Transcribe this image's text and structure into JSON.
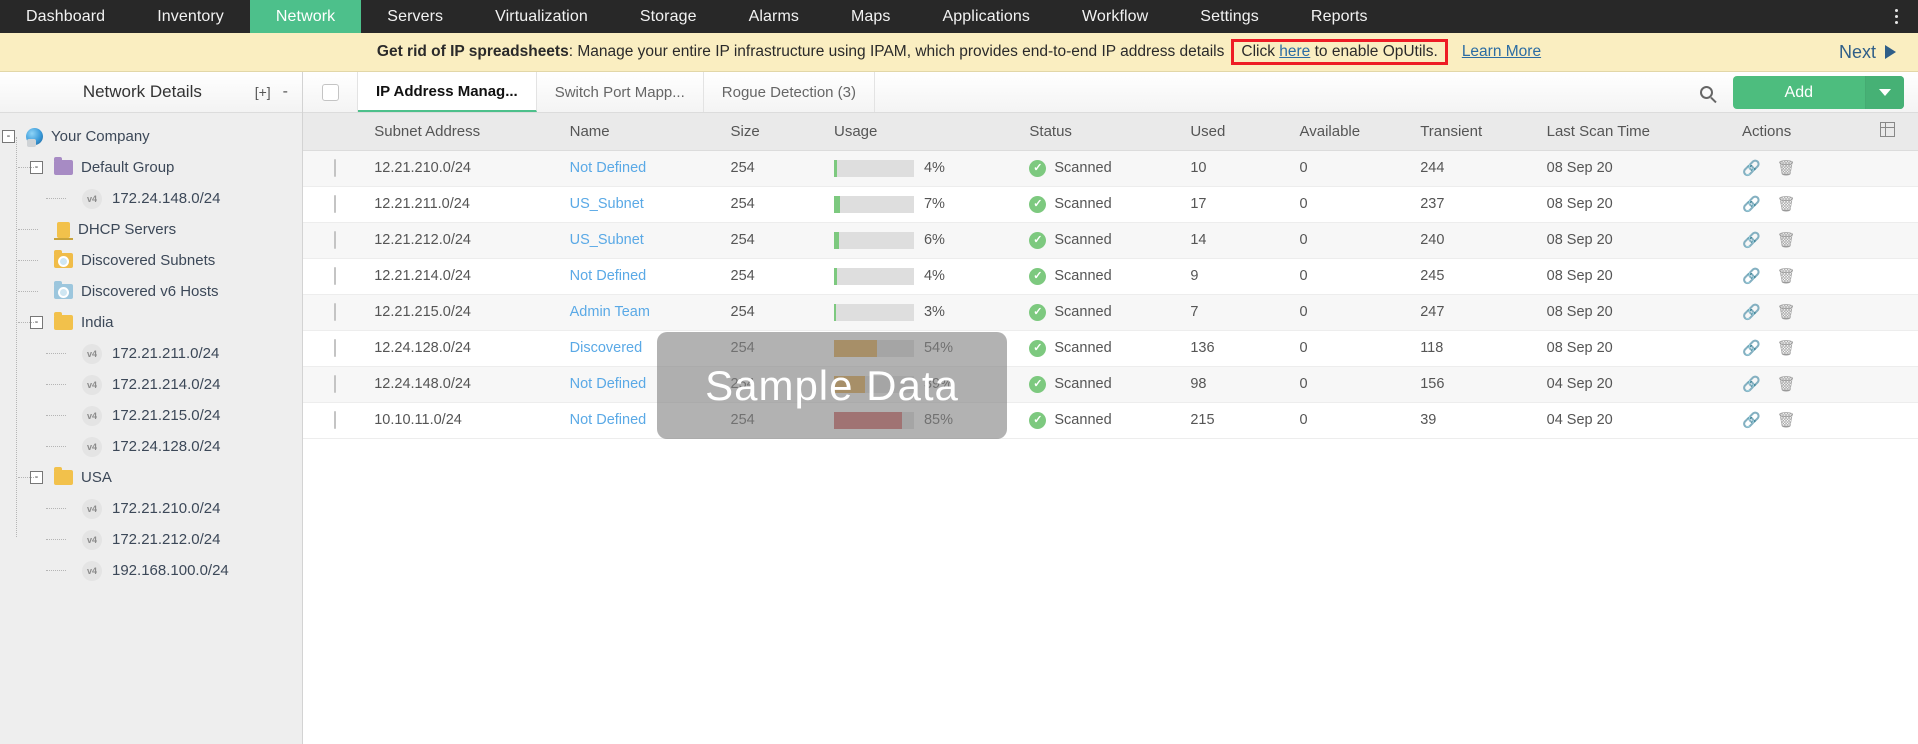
{
  "topnav": {
    "items": [
      {
        "label": "Dashboard",
        "active": false
      },
      {
        "label": "Inventory",
        "active": false
      },
      {
        "label": "Network",
        "active": true
      },
      {
        "label": "Servers",
        "active": false
      },
      {
        "label": "Virtualization",
        "active": false
      },
      {
        "label": "Storage",
        "active": false
      },
      {
        "label": "Alarms",
        "active": false
      },
      {
        "label": "Maps",
        "active": false
      },
      {
        "label": "Applications",
        "active": false
      },
      {
        "label": "Workflow",
        "active": false
      },
      {
        "label": "Settings",
        "active": false
      },
      {
        "label": "Reports",
        "active": false
      }
    ],
    "accent_color": "#4dc08b",
    "background_color": "#282828",
    "overflow_icon": "kebab-menu-icon"
  },
  "banner": {
    "bold_text": "Get rid of IP spreadsheets",
    "body_text": ": Manage your entire IP infrastructure using IPAM, which provides end-to-end IP address details",
    "cta_prefix": "Click ",
    "cta_link": "here",
    "cta_suffix": " to enable OpUtils.",
    "learn_more": "Learn More",
    "next_label": "Next",
    "highlight_color": "#ee1c25",
    "background_color": "#faeec1"
  },
  "sidebar": {
    "title": "Network Details",
    "expand_all": "[+]",
    "collapse_all": "-",
    "tree": [
      {
        "label": "Your Company",
        "icon": "globe-icon",
        "depth": 0,
        "toggle": "-"
      },
      {
        "label": "Default Group",
        "icon": "folder-purple-icon",
        "depth": 1,
        "toggle": "-"
      },
      {
        "label": "172.24.148.0/24",
        "icon": "ipv4-icon",
        "depth": 2,
        "toggle": ""
      },
      {
        "label": "DHCP Servers",
        "icon": "dhcp-server-icon",
        "depth": 1,
        "toggle": ""
      },
      {
        "label": "Discovered Subnets",
        "icon": "folder-search-icon",
        "depth": 1,
        "toggle": ""
      },
      {
        "label": "Discovered v6 Hosts",
        "icon": "folder-search-v6-icon",
        "depth": 1,
        "toggle": ""
      },
      {
        "label": "India",
        "icon": "folder-yellow-icon",
        "depth": 1,
        "toggle": "-"
      },
      {
        "label": "172.21.211.0/24",
        "icon": "ipv4-icon",
        "depth": 2,
        "toggle": ""
      },
      {
        "label": "172.21.214.0/24",
        "icon": "ipv4-icon",
        "depth": 2,
        "toggle": ""
      },
      {
        "label": "172.21.215.0/24",
        "icon": "ipv4-icon",
        "depth": 2,
        "toggle": ""
      },
      {
        "label": "172.24.128.0/24",
        "icon": "ipv4-icon",
        "depth": 2,
        "toggle": ""
      },
      {
        "label": "USA",
        "icon": "folder-yellow-icon",
        "depth": 1,
        "toggle": "-"
      },
      {
        "label": "172.21.210.0/24",
        "icon": "ipv4-icon",
        "depth": 2,
        "toggle": ""
      },
      {
        "label": "172.21.212.0/24",
        "icon": "ipv4-icon",
        "depth": 2,
        "toggle": ""
      },
      {
        "label": "192.168.100.0/24",
        "icon": "ipv4-icon",
        "depth": 2,
        "toggle": ""
      }
    ]
  },
  "toolbar": {
    "select_all_checkbox": "",
    "tabs": [
      {
        "label": "IP Address Manag...",
        "active": true
      },
      {
        "label": "Switch Port Mapp...",
        "active": false
      },
      {
        "label": "Rogue Detection (3)",
        "active": false
      }
    ],
    "search_icon": "search-icon",
    "add_label": "Add",
    "add_caret_icon": "chevron-down-icon",
    "add_color": "#4dbd7e"
  },
  "table": {
    "columns": [
      "Subnet Address",
      "Name",
      "Size",
      "Usage",
      "Status",
      "Used",
      "Available",
      "Transient",
      "Last Scan Time",
      "Actions"
    ],
    "grid_icon": "column-chooser-icon",
    "rows": [
      {
        "subnet": "12.21.210.0/24",
        "name": "Not Defined",
        "size": "254",
        "usage_pct": 4,
        "usage_label": "4%",
        "status": "Scanned",
        "used": "10",
        "available": "0",
        "transient": "244",
        "last_scan": "08 Sep 20",
        "bar_color": "#7dc97f"
      },
      {
        "subnet": "12.21.211.0/24",
        "name": "US_Subnet",
        "size": "254",
        "usage_pct": 7,
        "usage_label": "7%",
        "status": "Scanned",
        "used": "17",
        "available": "0",
        "transient": "237",
        "last_scan": "08 Sep 20",
        "bar_color": "#7dc97f"
      },
      {
        "subnet": "12.21.212.0/24",
        "name": "US_Subnet",
        "size": "254",
        "usage_pct": 6,
        "usage_label": "6%",
        "status": "Scanned",
        "used": "14",
        "available": "0",
        "transient": "240",
        "last_scan": "08 Sep 20",
        "bar_color": "#7dc97f"
      },
      {
        "subnet": "12.21.214.0/24",
        "name": "Not Defined",
        "size": "254",
        "usage_pct": 4,
        "usage_label": "4%",
        "status": "Scanned",
        "used": "9",
        "available": "0",
        "transient": "245",
        "last_scan": "08 Sep 20",
        "bar_color": "#7dc97f"
      },
      {
        "subnet": "12.21.215.0/24",
        "name": "Admin Team",
        "size": "254",
        "usage_pct": 3,
        "usage_label": "3%",
        "status": "Scanned",
        "used": "7",
        "available": "0",
        "transient": "247",
        "last_scan": "08 Sep 20",
        "bar_color": "#7dc97f"
      },
      {
        "subnet": "12.24.128.0/24",
        "name": "Discovered",
        "size": "254",
        "usage_pct": 54,
        "usage_label": "54%",
        "status": "Scanned",
        "used": "136",
        "available": "0",
        "transient": "118",
        "last_scan": "08 Sep 20",
        "bar_color": "#e2a33e"
      },
      {
        "subnet": "12.24.148.0/24",
        "name": "Not Defined",
        "size": "254",
        "usage_pct": 39,
        "usage_label": "39%",
        "status": "Scanned",
        "used": "98",
        "available": "0",
        "transient": "156",
        "last_scan": "04 Sep 20",
        "bar_color": "#e2a33e"
      },
      {
        "subnet": "10.10.11.0/24",
        "name": "Not Defined",
        "size": "254",
        "usage_pct": 85,
        "usage_label": "85%",
        "status": "Scanned",
        "used": "215",
        "available": "0",
        "transient": "39",
        "last_scan": "04 Sep 20",
        "bar_color": "#cf5b5b"
      }
    ],
    "action_icons": [
      "link-icon",
      "trash-icon"
    ]
  },
  "watermark": {
    "text": "Sample Data"
  }
}
